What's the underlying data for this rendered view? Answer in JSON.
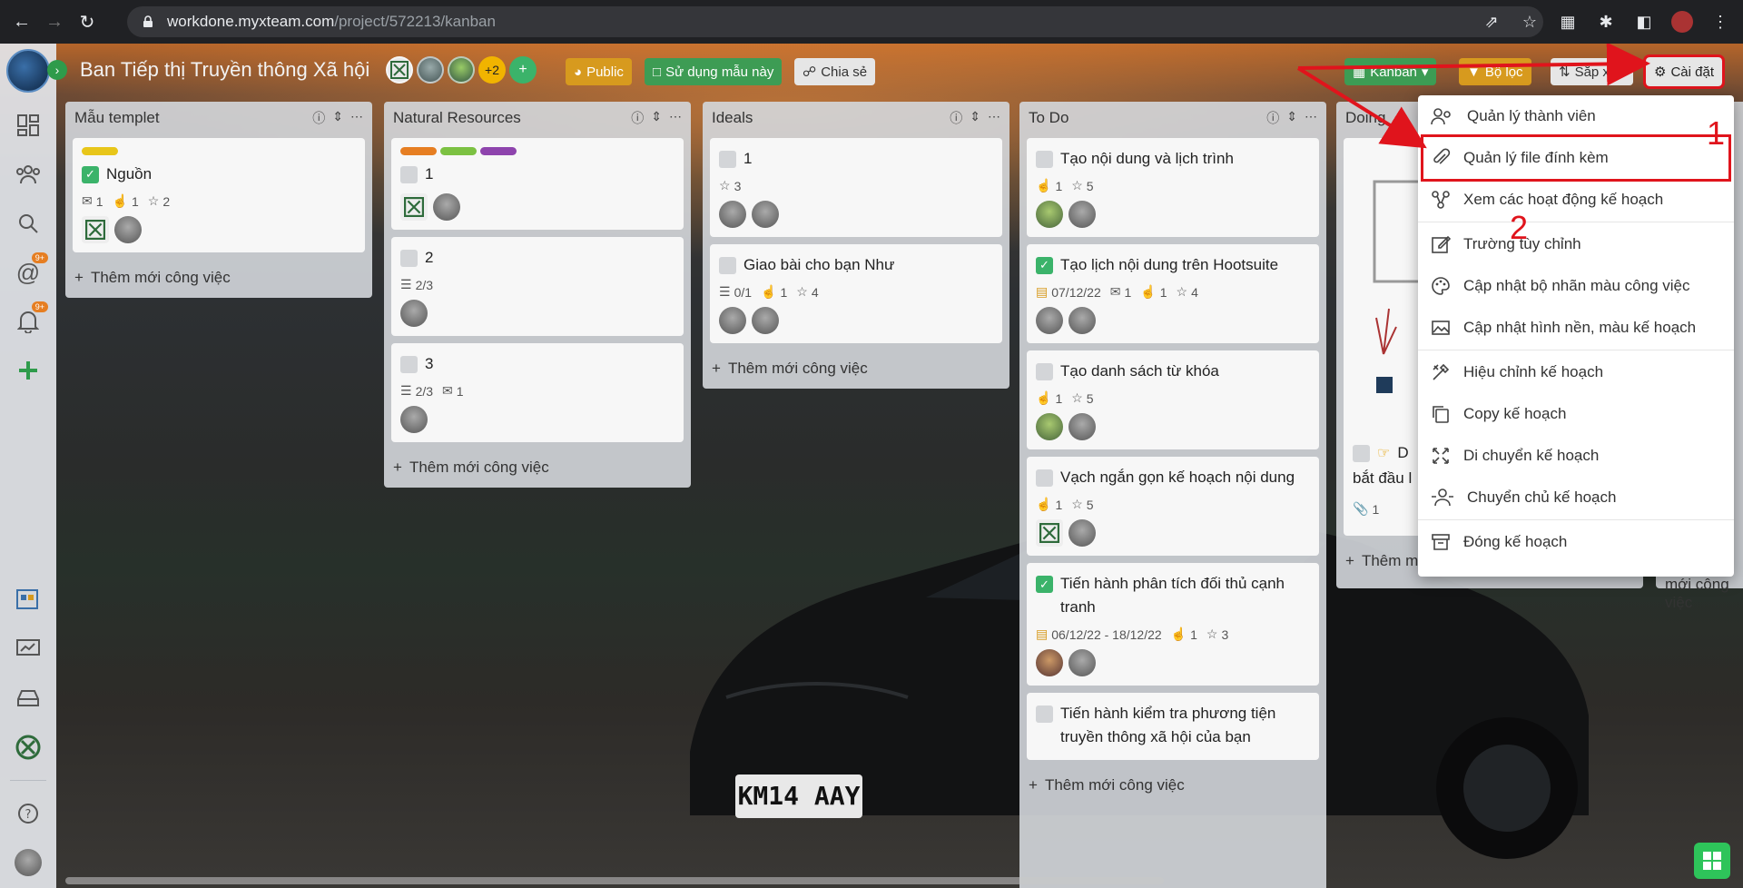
{
  "browser": {
    "url_host": "workdone.myxteam.com",
    "url_path": "/project/572213/kanban"
  },
  "header": {
    "title": "Ban Tiếp thị Truyền thông Xã hội",
    "more_members": "+2",
    "public_label": "Public",
    "template_label": "Sử dụng mẫu này",
    "share_label": "Chia sẻ",
    "kanban_label": "Kanban",
    "filter_label": "Bộ lọc",
    "sort_label": "Sắp xếp",
    "settings_label": "Cài đặt"
  },
  "sidebar": {
    "mention_badge": "9+",
    "notify_badge": "9+"
  },
  "add_task_label": "Thêm mới công việc",
  "columns": [
    {
      "title": "Mẫu templet",
      "cards": [
        {
          "title": "Nguồn",
          "comments": "1",
          "likes": "1",
          "stars": "2"
        }
      ]
    },
    {
      "title": "Natural Resources",
      "cards": [
        {
          "title": "1"
        },
        {
          "title": "2",
          "checklist": "2/3"
        },
        {
          "title": "3",
          "checklist": "2/3",
          "comments": "1"
        }
      ]
    },
    {
      "title": "Ideals",
      "cards": [
        {
          "title": "1",
          "stars": "3"
        },
        {
          "title": "Giao bài cho bạn Như",
          "checklist": "0/1",
          "likes": "1",
          "stars": "4"
        }
      ]
    },
    {
      "title": "To Do",
      "cards": [
        {
          "title": "Tạo nội dung và lịch trình",
          "likes": "1",
          "stars": "5"
        },
        {
          "title": "Tạo lịch nội dung trên Hootsuite",
          "date": "07/12/22",
          "comments": "1",
          "likes": "1",
          "stars": "4"
        },
        {
          "title": "Tạo danh sách từ khóa",
          "likes": "1",
          "stars": "5"
        },
        {
          "title": "Vạch ngắn gọn kế hoạch nội dung",
          "likes": "1",
          "stars": "5"
        },
        {
          "title": "Tiến hành phân tích đối thủ cạnh tranh",
          "date": "06/12/22 - 18/12/22",
          "likes": "1",
          "stars": "3"
        },
        {
          "title": "Tiến hành kiểm tra phương tiện truyền thông xã hội của bạn"
        }
      ]
    },
    {
      "title": "Doing",
      "cards": [
        {
          "title_partial": "D",
          "title_line2": "bắt đầu l",
          "attachments": "1"
        }
      ]
    }
  ],
  "settings_menu": {
    "items": [
      {
        "label": "Quản lý thành viên",
        "icon": "members-icon"
      },
      {
        "label": "Quản lý file đính kèm",
        "icon": "paperclip-icon"
      },
      {
        "label": "Xem các hoạt động kế hoạch",
        "icon": "activity-icon"
      },
      {
        "label": "Trường tùy chỉnh",
        "icon": "edit-icon"
      },
      {
        "label": "Cập nhật bộ nhãn màu công việc",
        "icon": "palette-icon"
      },
      {
        "label": "Cập nhật hình nền, màu kế hoạch",
        "icon": "image-icon"
      },
      {
        "label": "Hiệu chỉnh kế hoạch",
        "icon": "tools-icon"
      },
      {
        "label": "Copy kế hoạch",
        "icon": "copy-icon"
      },
      {
        "label": "Di chuyển kế hoạch",
        "icon": "move-icon"
      },
      {
        "label": "Chuyển chủ kế hoạch",
        "icon": "transfer-icon"
      },
      {
        "label": "Đóng kế hoạch",
        "icon": "archive-icon"
      }
    ]
  },
  "annotations": {
    "step1": "1",
    "step2": "2"
  },
  "colors": {
    "accent_green": "#3bb36a",
    "accent_orange": "#d79a1e",
    "highlight_red": "#e0141c"
  },
  "car_plate": "KM14 AAY"
}
